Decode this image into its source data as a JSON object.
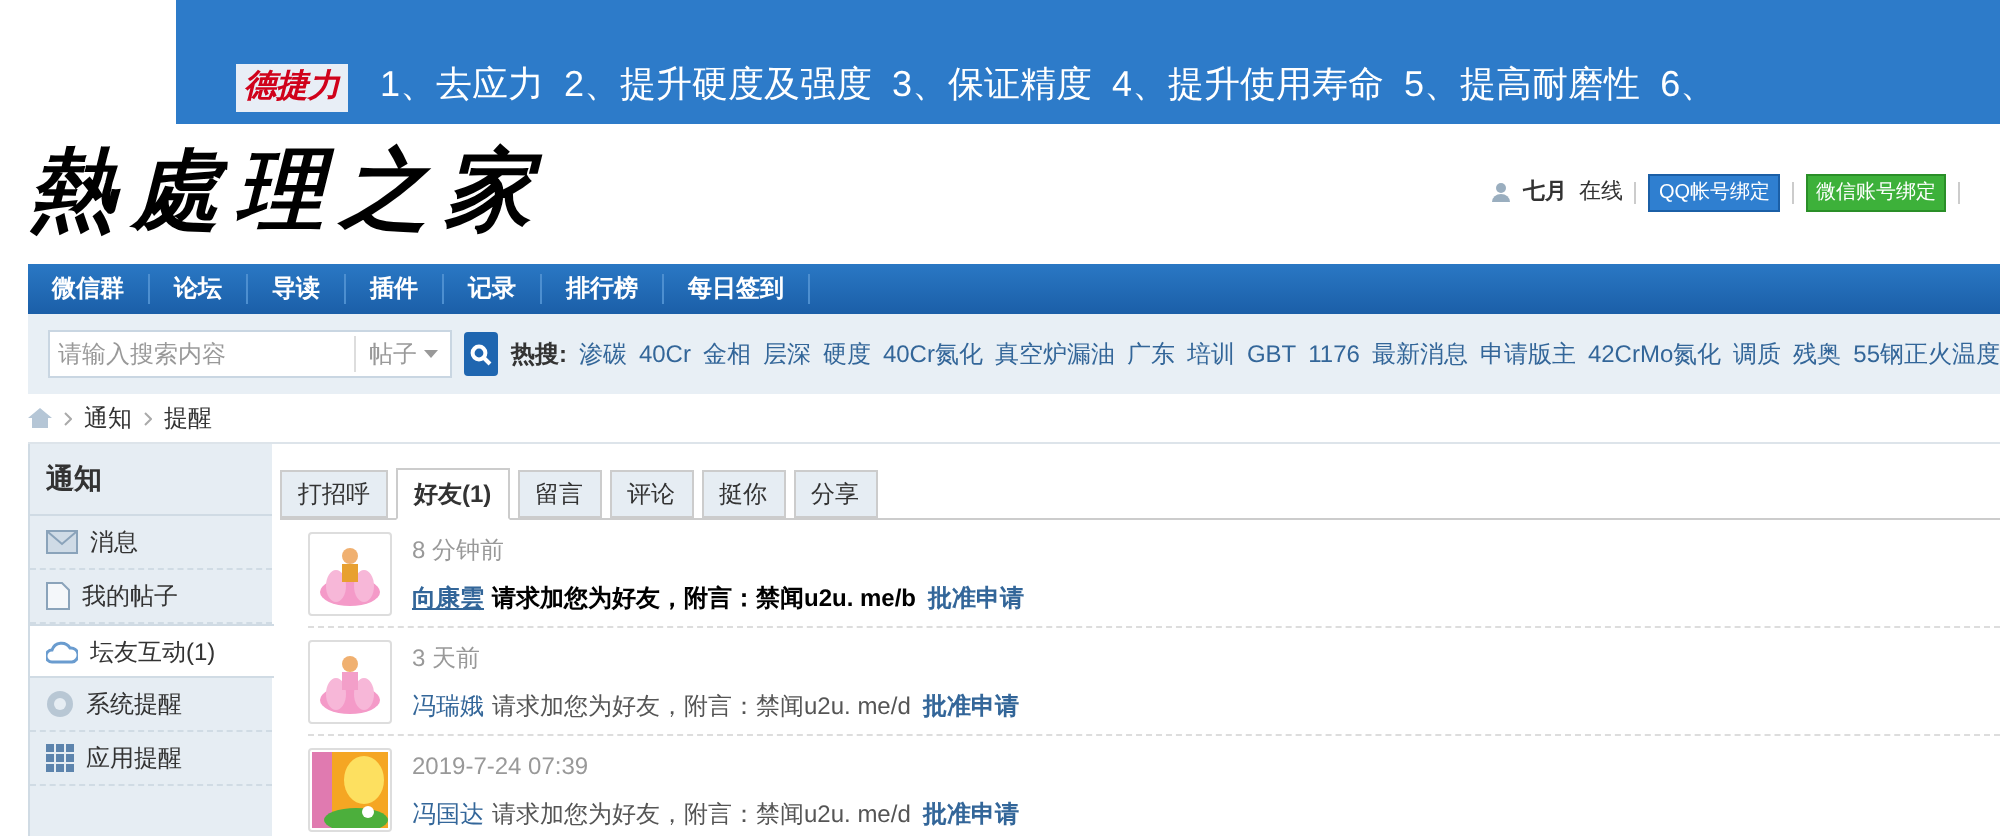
{
  "banner": {
    "brand": "德捷力",
    "slogan": "1、去应力  2、提升硬度及强度  3、保证精度  4、提升使用寿命  5、提高耐磨性  6、"
  },
  "logo": "熱處理之家",
  "user_bar": {
    "username": "七月",
    "status": "在线",
    "qq_bind": "QQ帐号绑定",
    "wechat_bind": "微信账号绑定"
  },
  "nav": [
    "微信群",
    "论坛",
    "导读",
    "插件",
    "记录",
    "排行榜",
    "每日签到"
  ],
  "search": {
    "placeholder": "请输入搜索内容",
    "scope": "帖子",
    "hot_label": "热搜:",
    "hot": [
      "渗碳",
      "40Cr",
      "金相",
      "层深",
      "硬度",
      "40Cr氮化",
      "真空炉漏油",
      "广东",
      "培训",
      "GBT",
      "1176",
      "最新消息",
      "申请版主",
      "42CrMo氮化",
      "调质",
      "残奥",
      "55钢正火温度"
    ]
  },
  "breadcrumb": [
    "通知",
    "提醒"
  ],
  "sidebar": {
    "title": "通知",
    "items": [
      {
        "label": "消息",
        "kind": "mail",
        "selected": false
      },
      {
        "label": "我的帖子",
        "kind": "doc",
        "selected": false
      },
      {
        "label": "坛友互动(1)",
        "kind": "cloud",
        "selected": true
      },
      {
        "label": "系统提醒",
        "kind": "gear",
        "selected": false
      },
      {
        "label": "应用提醒",
        "kind": "grid",
        "selected": false
      }
    ]
  },
  "tabs": [
    {
      "label": "打招呼",
      "selected": false
    },
    {
      "label": "好友(1)",
      "selected": true
    },
    {
      "label": "留言",
      "selected": false
    },
    {
      "label": "评论",
      "selected": false
    },
    {
      "label": "挺你",
      "selected": false
    },
    {
      "label": "分享",
      "selected": false
    }
  ],
  "notices": [
    {
      "time": "8 分钟前",
      "user": "向康雲",
      "message": "请求加您为好友，附言：禁闻u2u. me/b",
      "action": "批准申请",
      "unread": true
    },
    {
      "time": "3 天前",
      "user": "冯瑞娥",
      "message": "请求加您为好友，附言：禁闻u2u. me/d",
      "action": "批准申请",
      "unread": false
    },
    {
      "time": "2019-7-24 07:39",
      "user": "冯国达",
      "message": "请求加您为好友，附言：禁闻u2u. me/d",
      "action": "批准申请",
      "unread": false
    }
  ]
}
